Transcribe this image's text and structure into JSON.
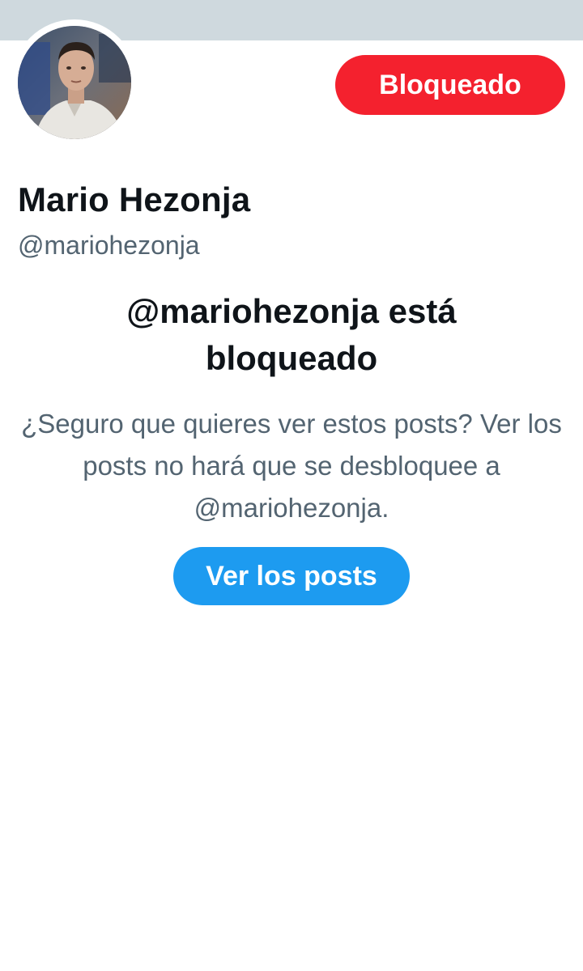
{
  "profile": {
    "display_name": "Mario Hezonja",
    "handle": "@mariohezonja",
    "blocked_label": "Bloqueado"
  },
  "blocked_notice": {
    "headline": "@mariohezonja está bloqueado",
    "message": "¿Seguro que quieres ver estos posts? Ver los posts no hará que se desbloquee a @mariohezonja.",
    "view_posts_label": "Ver los posts"
  },
  "colors": {
    "banner": "#cfd9de",
    "blocked_button": "#f4212e",
    "view_button": "#1d9bf0",
    "primary_text": "#0f1419",
    "secondary_text": "#536471"
  }
}
